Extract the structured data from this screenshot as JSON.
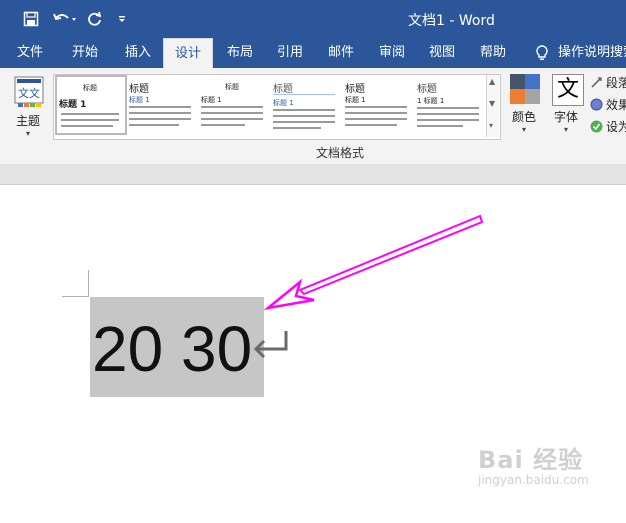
{
  "window": {
    "title": "文档1  -  Word"
  },
  "qat": {
    "save_icon": "save-icon",
    "undo_icon": "undo-icon",
    "redo_icon": "redo-icon",
    "customize_icon": "customize-qat-icon"
  },
  "tabs": [
    {
      "label": "文件"
    },
    {
      "label": "开始"
    },
    {
      "label": "插入"
    },
    {
      "label": "设计",
      "active": true
    },
    {
      "label": "布局"
    },
    {
      "label": "引用"
    },
    {
      "label": "邮件"
    },
    {
      "label": "审阅"
    },
    {
      "label": "视图"
    },
    {
      "label": "帮助"
    }
  ],
  "tell_me": {
    "label": "操作说明搜索"
  },
  "ribbon": {
    "theme_label": "主题",
    "theme_icon_text": "文文",
    "gallery": [
      {
        "title": "标题",
        "heading": "标题 1"
      },
      {
        "title": "标题",
        "heading": "标题 1"
      },
      {
        "title": "标题",
        "heading": "标题 1"
      },
      {
        "title": "标题",
        "heading": "标题 1"
      },
      {
        "title": "标题",
        "heading": "标题 1"
      },
      {
        "title": "标题",
        "heading": "1  标题 1"
      }
    ],
    "colors_label": "颜色",
    "fonts_label": "字体",
    "fonts_icon_text": "文",
    "group_label": "文档格式",
    "side": [
      {
        "label": "段落"
      },
      {
        "label": "效果"
      },
      {
        "label": "设为"
      }
    ],
    "accent_colors": [
      "#44546a",
      "#4472c4",
      "#ed7d31",
      "#a5a5a5"
    ]
  },
  "document": {
    "text": "20 30",
    "paragraph_mark": "↵"
  },
  "annotation": {
    "color": "#ff00ff"
  },
  "watermark": {
    "text": "Bai 经验",
    "url": "jingyan.baidu.com"
  }
}
